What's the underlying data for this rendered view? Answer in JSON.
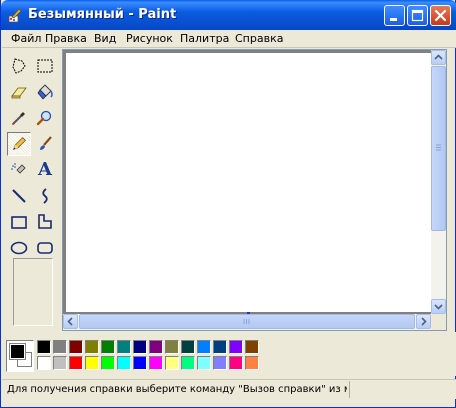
{
  "window": {
    "title": "Безымянный - Paint",
    "icon": "paint-app-icon",
    "controls": [
      "minimize-icon",
      "maximize-icon",
      "close-icon"
    ]
  },
  "menu": {
    "items": [
      {
        "label": "Файл"
      },
      {
        "label": "Правка"
      },
      {
        "label": "Вид"
      },
      {
        "label": "Рисунок"
      },
      {
        "label": "Палитра"
      },
      {
        "label": "Справка"
      }
    ]
  },
  "tools": [
    {
      "name": "free-form-select-icon"
    },
    {
      "name": "rect-select-icon"
    },
    {
      "name": "eraser-icon"
    },
    {
      "name": "fill-bucket-icon"
    },
    {
      "name": "color-picker-icon"
    },
    {
      "name": "magnifier-icon"
    },
    {
      "name": "pencil-icon",
      "selected": true
    },
    {
      "name": "brush-icon"
    },
    {
      "name": "airbrush-icon"
    },
    {
      "name": "text-icon"
    },
    {
      "name": "line-icon"
    },
    {
      "name": "curve-icon"
    },
    {
      "name": "rectangle-icon"
    },
    {
      "name": "polygon-icon"
    },
    {
      "name": "ellipse-icon"
    },
    {
      "name": "rounded-rect-icon"
    }
  ],
  "text_tool_glyph": "A",
  "palette": {
    "foreground": "#000000",
    "background": "#ffffff",
    "row1": [
      "#000000",
      "#808080",
      "#800000",
      "#808000",
      "#008000",
      "#008080",
      "#000080",
      "#800080",
      "#808040",
      "#004040",
      "#0080ff",
      "#004080",
      "#8000ff",
      "#804000"
    ],
    "row2": [
      "#ffffff",
      "#c0c0c0",
      "#ff0000",
      "#ffff00",
      "#00ff00",
      "#00ffff",
      "#0000ff",
      "#ff00ff",
      "#ffff80",
      "#00ff80",
      "#80ffff",
      "#8080ff",
      "#ff0080",
      "#ff8040"
    ]
  },
  "status": {
    "help_text": "Для получения справки выберите команду \"Вызов справки\" из меню"
  }
}
